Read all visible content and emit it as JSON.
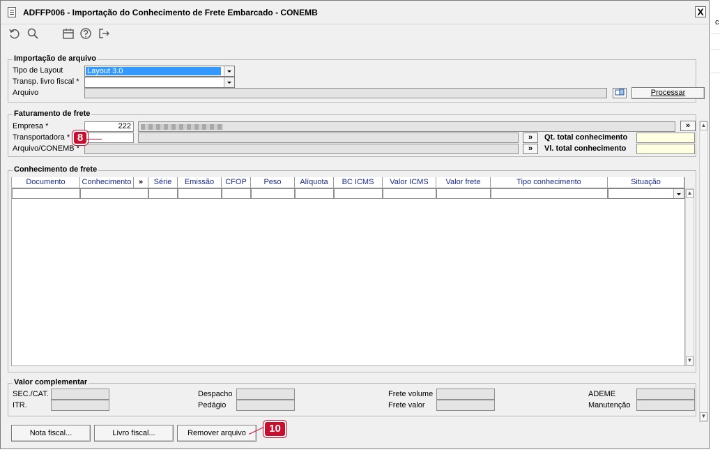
{
  "window": {
    "title": "ADFFP006 - Importação do Conhecimento de Frete Embarcado - CONEMB",
    "close_label": "X"
  },
  "toolbar": {
    "icons": [
      "undo-icon",
      "search-icon",
      "calendar-icon",
      "help-icon",
      "exit-icon"
    ]
  },
  "import_file": {
    "group_title": "Importação de arquivo",
    "layout_label": "Tipo de Layout",
    "layout_value": "Layout 3.0",
    "transp_label": "Transp. livro fiscal *",
    "transp_value": "",
    "file_label": "Arquivo",
    "file_value": "",
    "process_button": "Processar"
  },
  "billing": {
    "group_title": "Faturamento de frete",
    "company_label": "Empresa *",
    "company_value": "222",
    "carrier_label": "Transportadora *",
    "carrier_value": "",
    "conemb_label": "Arquivo/CONEMB *",
    "conemb_value": "",
    "qt_label": "Qt. total conhecimento",
    "qt_value": "",
    "vl_label": "Vl. total conhecimento",
    "vl_value": "",
    "more_label": "»"
  },
  "grid": {
    "group_title": "Conhecimento de frete",
    "columns": [
      "Documento",
      "Conhecimento",
      "»",
      "Série",
      "Emissão",
      "CFOP",
      "Peso",
      "Alíquota",
      "BC ICMS",
      "Valor ICMS",
      "Valor frete",
      "Tipo conhecimento",
      "Situação"
    ],
    "rows": []
  },
  "complement": {
    "group_title": "Valor complementar",
    "sec_cat": "SEC./CAT.",
    "itr": "ITR.",
    "despacho": "Despacho",
    "pedagio": "Pedágio",
    "frete_volume": "Frete volume",
    "frete_valor": "Frete valor",
    "ademe": "ADEME",
    "manutencao": "Manutenção"
  },
  "footer": {
    "nota_fiscal": "Nota fiscal...",
    "livro_fiscal": "Livro fiscal...",
    "remover": "Remover arquivo"
  },
  "annotations": {
    "badge_8": "8",
    "badge_10": "10"
  },
  "outside": {
    "edge_char": "c"
  },
  "colors": {
    "badge": "#c8102e",
    "selection": "#3399ff",
    "required_yellow": "#ffffe1",
    "header_text": "#1a2a8c"
  }
}
